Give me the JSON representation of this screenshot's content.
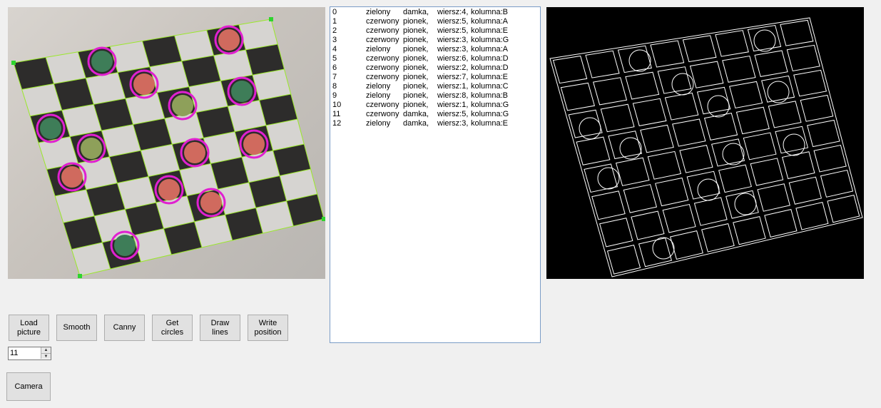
{
  "buttons": {
    "load": "Load\npicture",
    "smooth": "Smooth",
    "canny": "Canny",
    "circles": "Get\ncircles",
    "lines": "Draw\nlines",
    "write": "Write\nposition",
    "camera": "Camera"
  },
  "stepper": {
    "value": "11"
  },
  "icons": {
    "up": "triangle-up",
    "down": "triangle-down"
  },
  "colors": {
    "detected_circle": "#e020d0",
    "grid_line": "#9ae82a",
    "listbox_border": "#7a9cc6"
  },
  "results": [
    [
      "0",
      "zielony",
      "damka,",
      "wiersz:4,",
      "kolumna:B"
    ],
    [
      "1",
      "czerwony",
      "pionek,",
      "wiersz:5,",
      "kolumna:A"
    ],
    [
      "2",
      "czerwony",
      "pionek,",
      "wiersz:5,",
      "kolumna:E"
    ],
    [
      "3",
      "czerwony",
      "pionek,",
      "wiersz:3,",
      "kolumna:G"
    ],
    [
      "4",
      "zielony",
      "pionek,",
      "wiersz:3,",
      "kolumna:A"
    ],
    [
      "5",
      "czerwony",
      "pionek,",
      "wiersz:6,",
      "kolumna:D"
    ],
    [
      "6",
      "czerwony",
      "pionek,",
      "wiersz:2,",
      "kolumna:D"
    ],
    [
      "7",
      "czerwony",
      "pionek,",
      "wiersz:7,",
      "kolumna:E"
    ],
    [
      "8",
      "zielony",
      "pionek,",
      "wiersz:1,",
      "kolumna:C"
    ],
    [
      "9",
      "zielony",
      "pionek,",
      "wiersz:8,",
      "kolumna:B"
    ],
    [
      "10",
      "czerwony",
      "pionek,",
      "wiersz:1,",
      "kolumna:G"
    ],
    [
      "11",
      "czerwony",
      "damka,",
      "wiersz:5,",
      "kolumna:G"
    ],
    [
      "12",
      "zielony",
      "damka,",
      "wiersz:3,",
      "kolumna:E"
    ]
  ]
}
